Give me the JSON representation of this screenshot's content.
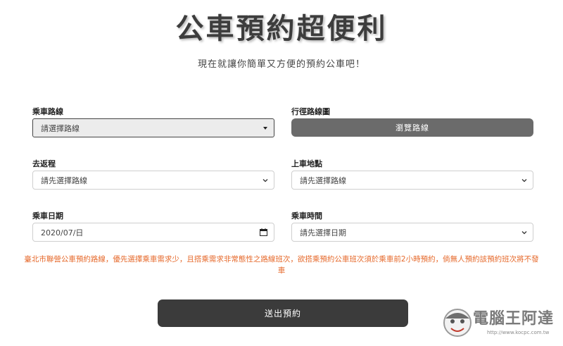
{
  "page": {
    "title": "公車預約超便利",
    "subtitle": "現在就讓你簡單又方便的預約公車吧！"
  },
  "form": {
    "route": {
      "label": "乘車路線",
      "value": "請選擇路線"
    },
    "route_map": {
      "label": "行徑路線圖",
      "button": "瀏覽路線"
    },
    "direction": {
      "label": "去返程",
      "value": "請先選擇路線"
    },
    "stop": {
      "label": "上車地點",
      "value": "請先選擇路線"
    },
    "date": {
      "label": "乘車日期",
      "value": "2020/07/日"
    },
    "time": {
      "label": "乘車時間",
      "value": "請先選擇日期"
    },
    "notice": "臺北市聯營公車預約路線，優先選擇乘車需求少，且搭乘需求非常態性之路線班次，欲搭乘預約公車班次須於乘車前2小時預約，倘無人預約該預約班次將不發車",
    "submit": "送出預約"
  },
  "watermark": {
    "text": "電腦王阿達",
    "url": "http://www.kocpc.com.tw"
  },
  "colors": {
    "notice": "#e66a2c",
    "map_button": "#6b6b6b",
    "submit_button": "#3b3b3b"
  }
}
